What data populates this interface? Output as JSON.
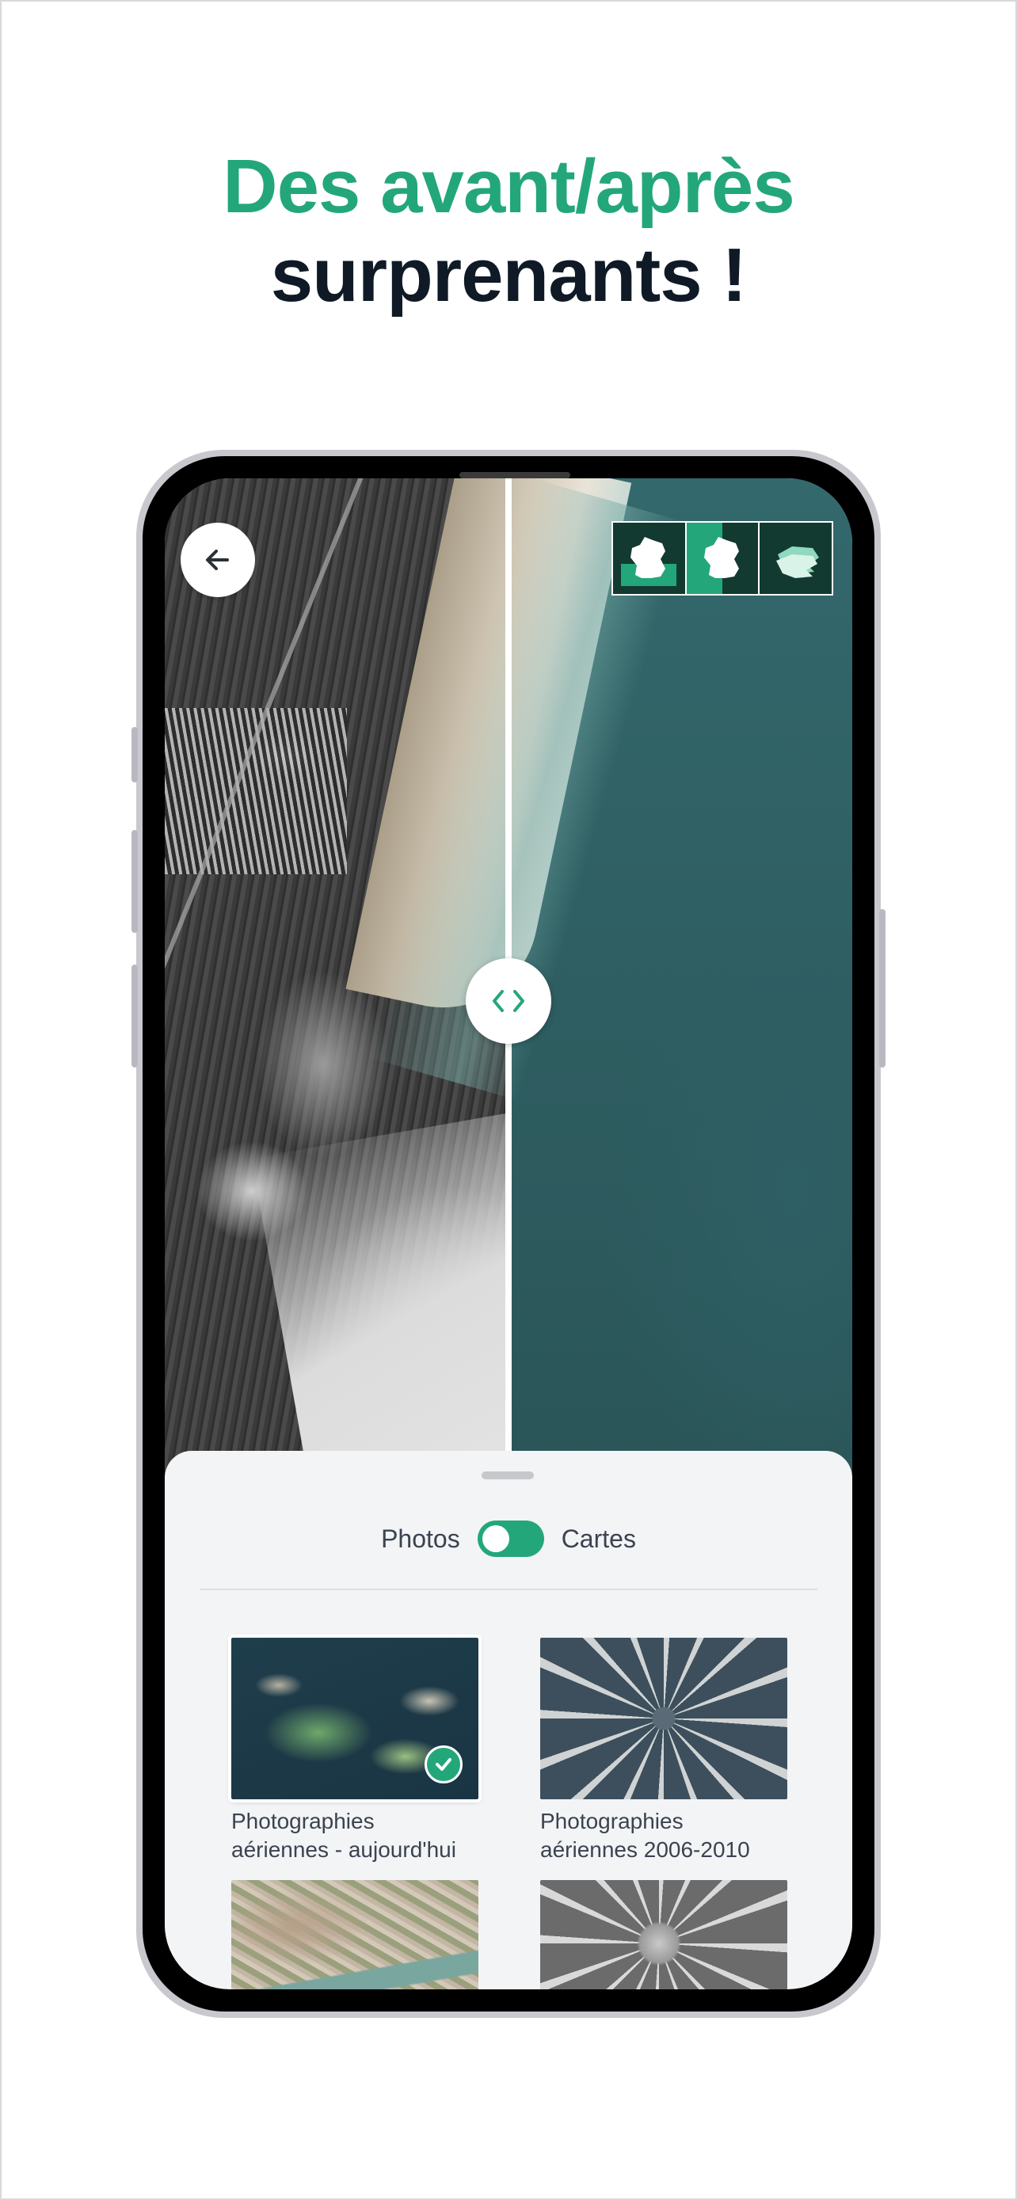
{
  "headline": {
    "line1": "Des avant/après",
    "line2": "surprenants !"
  },
  "colors": {
    "accent": "#23a77a",
    "headline_dark": "#0f1a26",
    "sheet_bg": "#f3f4f6"
  },
  "map": {
    "icons": {
      "back": "arrow-left-icon",
      "handle": "chevrons-left-right-icon",
      "regions": [
        "france-mainland-icon",
        "france-split-icon",
        "france-3d-icon"
      ]
    }
  },
  "sheet": {
    "toggle": {
      "left_label": "Photos",
      "right_label": "Cartes",
      "state": "on"
    },
    "layers": [
      {
        "caption_line1": "Photographies",
        "caption_line2": "aériennes - aujourd'hui",
        "selected": true
      },
      {
        "caption_line1": "Photographies",
        "caption_line2": "aériennes 2006-2010",
        "selected": false
      },
      {
        "caption_line1": "",
        "caption_line2": "",
        "selected": false
      },
      {
        "caption_line1": "",
        "caption_line2": "",
        "selected": false
      }
    ]
  }
}
